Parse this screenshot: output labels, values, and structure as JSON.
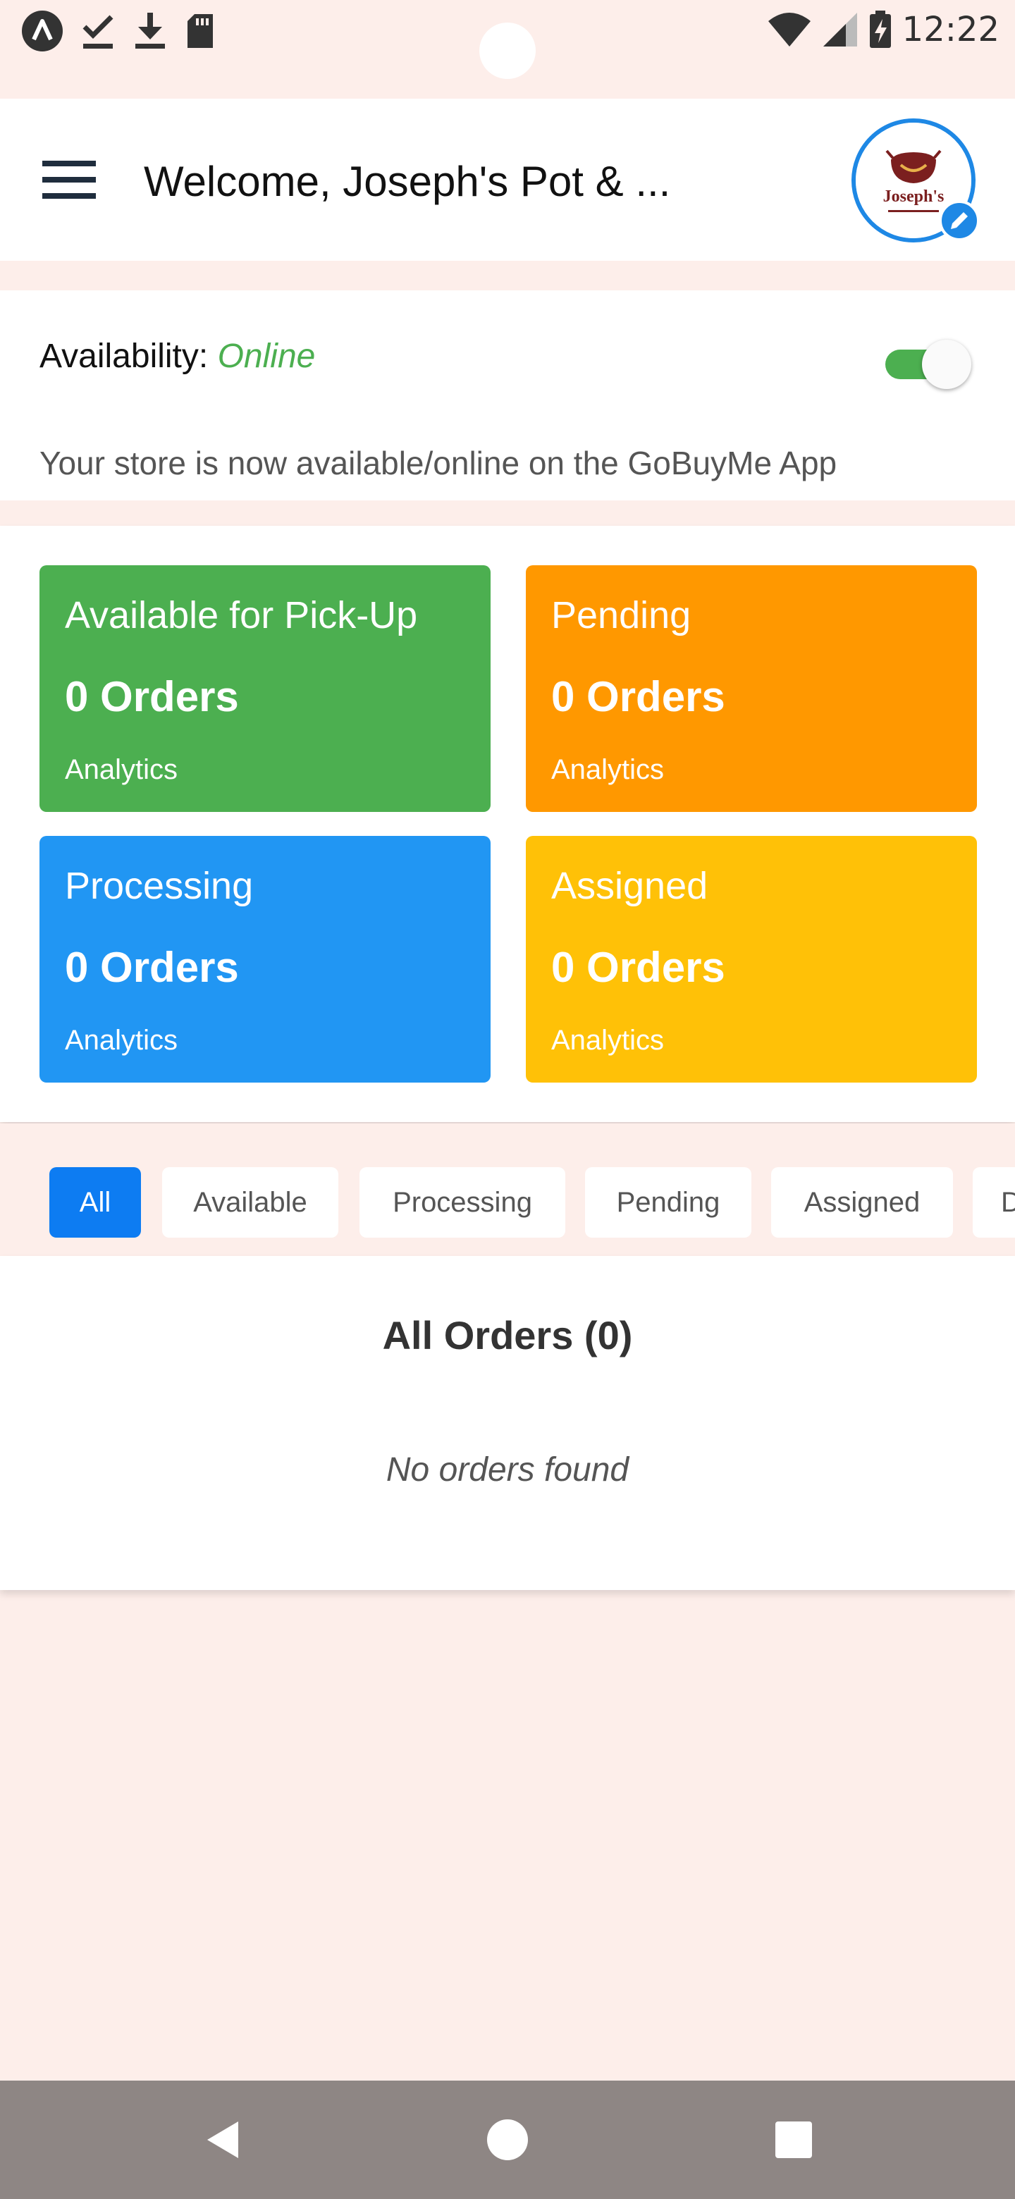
{
  "status_bar": {
    "time": "12:22"
  },
  "header": {
    "title": "Welcome, Joseph's Pot & ...",
    "logo_text": "Joseph's"
  },
  "availability": {
    "label": "Availability:",
    "status": "Online",
    "message": "Your store is now available/online on the GoBuyMe App",
    "toggle_on": true
  },
  "stats": [
    {
      "title": "Available for Pick-Up",
      "count": "0 Orders",
      "link": "Analytics",
      "color": "#4caf50"
    },
    {
      "title": "Pending",
      "count": "0 Orders",
      "link": "Analytics",
      "color": "#ff9800"
    },
    {
      "title": "Processing",
      "count": "0 Orders",
      "link": "Analytics",
      "color": "#2196f3"
    },
    {
      "title": "Assigned",
      "count": "0 Orders",
      "link": "Analytics",
      "color": "#ffc107"
    }
  ],
  "filters": [
    {
      "label": "All",
      "active": true
    },
    {
      "label": "Available",
      "active": false
    },
    {
      "label": "Processing",
      "active": false
    },
    {
      "label": "Pending",
      "active": false
    },
    {
      "label": "Assigned",
      "active": false
    },
    {
      "label": "D",
      "active": false
    }
  ],
  "orders": {
    "title": "All Orders (0)",
    "empty_message": "No  orders found"
  },
  "colors": {
    "accent": "#1e88e5",
    "background": "#fdeeea",
    "online": "#4caf50",
    "active_chip": "#0d7cf2"
  }
}
